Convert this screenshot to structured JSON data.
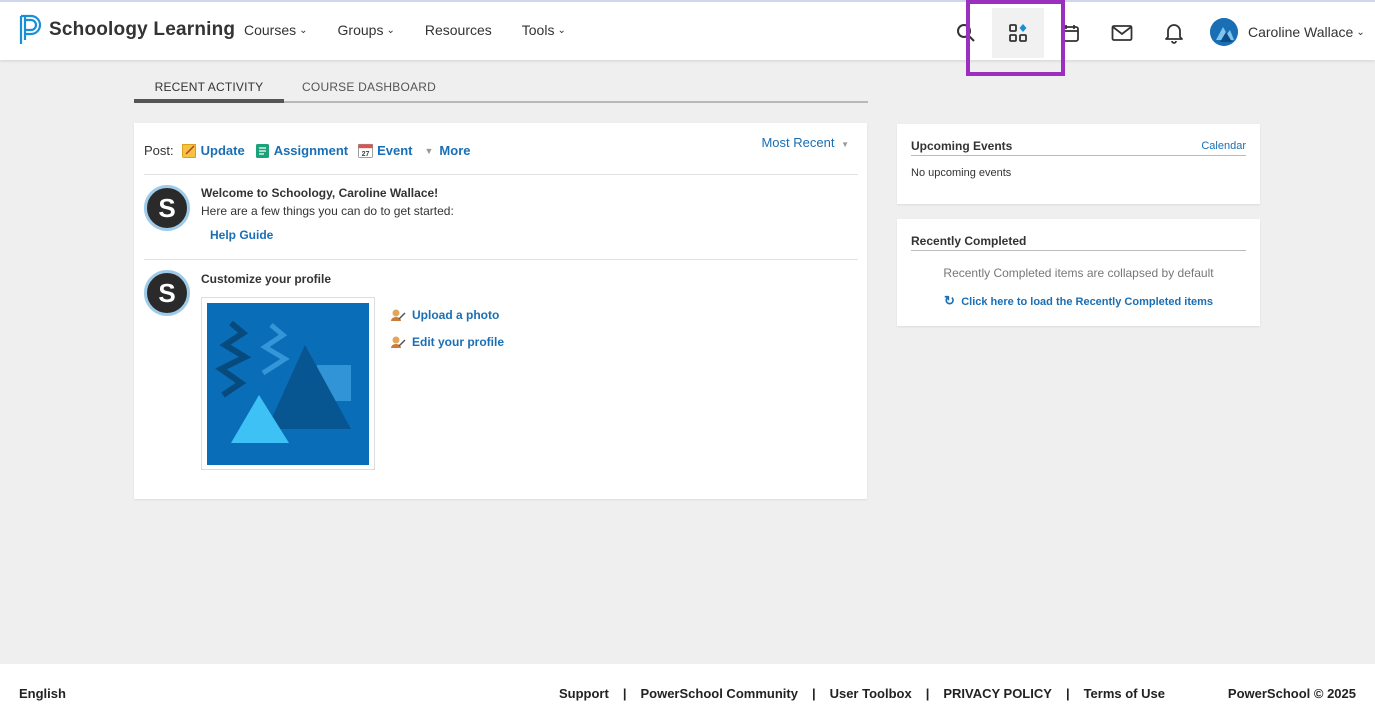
{
  "brand": {
    "name": "Schoology Learning"
  },
  "nav": {
    "links": [
      {
        "label": "Courses",
        "has_menu": true
      },
      {
        "label": "Groups",
        "has_menu": true
      },
      {
        "label": "Resources",
        "has_menu": false
      },
      {
        "label": "Tools",
        "has_menu": true
      }
    ],
    "icons": [
      "search-icon",
      "apps-icon",
      "calendar-icon",
      "mail-icon",
      "bell-icon"
    ],
    "user_name": "Caroline Wallace"
  },
  "tabs": {
    "recent": "RECENT ACTIVITY",
    "dashboard": "COURSE DASHBOARD"
  },
  "post": {
    "label": "Post:",
    "update": "Update",
    "assignment": "Assignment",
    "event": "Event",
    "event_day": "27",
    "more": "More",
    "sort": "Most Recent"
  },
  "feed": {
    "welcome_title": "Welcome to Schoology, Caroline Wallace!",
    "welcome_text": "Here are a few things you can do to get started:",
    "help_guide": "Help Guide",
    "customize_title": "Customize your profile",
    "upload_photo": "Upload a photo",
    "edit_profile": "Edit your profile",
    "avatar_letter": "S"
  },
  "events": {
    "title": "Upcoming Events",
    "calendar_link": "Calendar",
    "empty": "No upcoming events"
  },
  "completed": {
    "title": "Recently Completed",
    "note": "Recently Completed items are collapsed by default",
    "load_link": "Click here to load the Recently Completed items"
  },
  "footer": {
    "language": "English",
    "links": [
      "Support",
      "PowerSchool Community",
      "User Toolbox",
      "PRIVACY POLICY",
      "Terms of Use"
    ],
    "separator": "|",
    "copyright": "PowerSchool © 2025"
  },
  "colors": {
    "link": "#1a6fb4",
    "highlight": "#9b2fbf",
    "brand": "#1a8fd6"
  }
}
